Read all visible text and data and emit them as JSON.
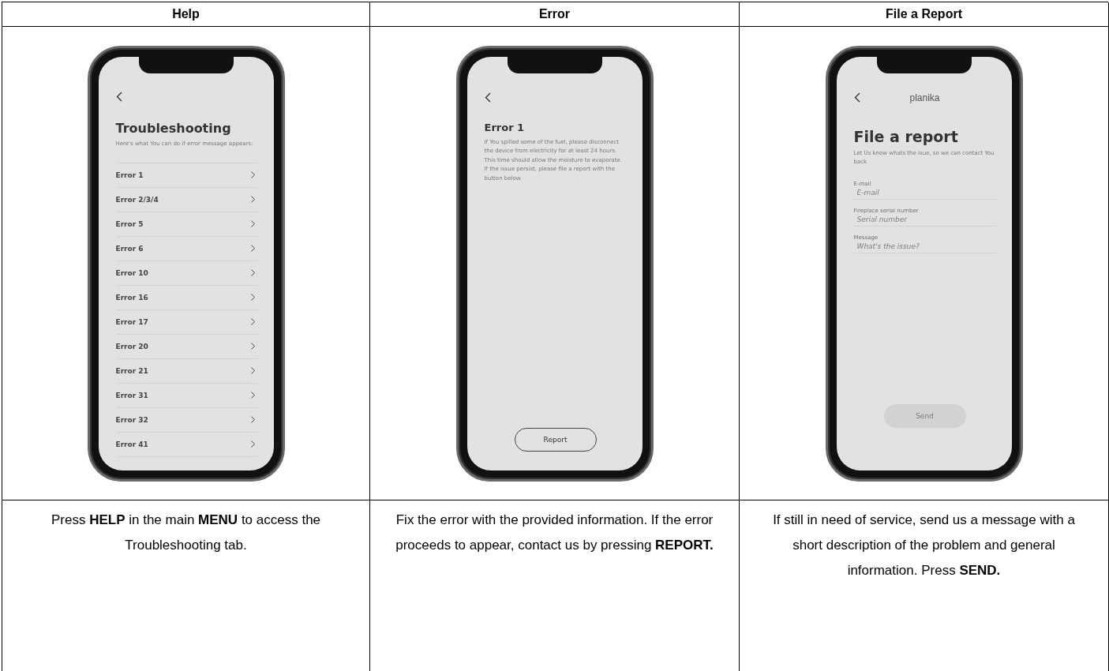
{
  "columns": [
    {
      "heading": "Help",
      "screen": {
        "kind": "list",
        "title": "Troubleshooting",
        "subtitle": "Here's what You can do if error message appears:",
        "items": [
          "Error 1",
          "Error 2/3/4",
          "Error 5",
          "Error 6",
          "Error 10",
          "Error 16",
          "Error 17",
          "Error 20",
          "Error 21",
          "Error 31",
          "Error 32",
          "Error 41"
        ]
      },
      "caption": "Press **HELP** in the main **MENU** to access the Troubleshooting tab."
    },
    {
      "heading": "Error",
      "screen": {
        "kind": "detail",
        "title": "Error 1",
        "body": "If You spilled some of the fuel, please disconnect the device from electricity for at least 24 hours. This time should allow the moisture to evaporate. If the issue persist, please file a report with the button below.",
        "button": {
          "label": "Report",
          "disabled": false
        }
      },
      "caption": "Fix the error with the provided information. If the error proceeds to appear, contact us by pressing **REPORT.**"
    },
    {
      "heading": "File a Report",
      "screen": {
        "kind": "form",
        "brand": "planika",
        "title": "File a report",
        "subtitle": "Let Us know whats the isue, so we can contact You back",
        "fields": [
          {
            "label": "E-mail",
            "placeholder": "E-mail"
          },
          {
            "label": "Fireplace serial number",
            "placeholder": "Serial number"
          },
          {
            "label": "Message",
            "placeholder": "What's the issue?"
          }
        ],
        "button": {
          "label": "Send",
          "disabled": true
        }
      },
      "caption": "If still in need of service, send us a message with a short description of the problem and general information. Press **SEND.**"
    }
  ]
}
